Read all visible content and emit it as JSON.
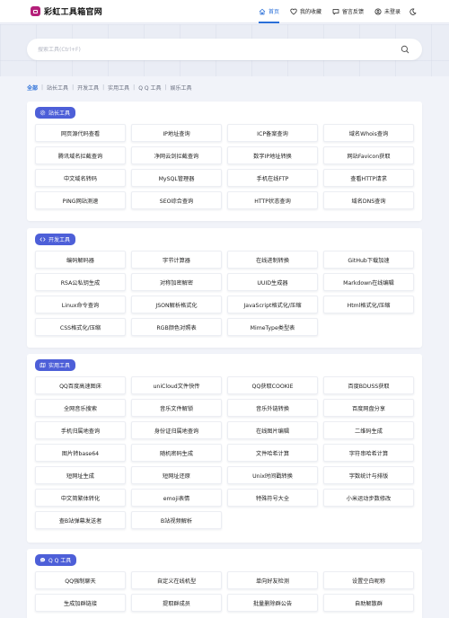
{
  "header": {
    "brand": "彩虹工具箱官网",
    "nav": [
      {
        "label": "首页",
        "icon": "home-icon",
        "active": true
      },
      {
        "label": "我的收藏",
        "icon": "heart-icon",
        "active": false
      },
      {
        "label": "留言反馈",
        "icon": "message-icon",
        "active": false
      },
      {
        "label": "未登录",
        "icon": "user-icon",
        "active": false
      }
    ],
    "theme_icon": "moon-icon"
  },
  "search": {
    "placeholder": "搜索工具(Ctrl+F)",
    "value": ""
  },
  "categories": [
    {
      "label": "全部",
      "active": true
    },
    {
      "label": "站长工具"
    },
    {
      "label": "开发工具"
    },
    {
      "label": "实用工具"
    },
    {
      "label": "Q Q 工具"
    },
    {
      "label": "娱乐工具"
    }
  ],
  "colors": {
    "accent": "#2a6fd8",
    "tag": "#4d5fd8",
    "brand": "#b4207a"
  },
  "sections": [
    {
      "title": "站长工具",
      "icon": "gear-icon",
      "tools": [
        "网页源代码查看",
        "IP地址查询",
        "ICP备案查询",
        "域名Whois查询",
        "腾讯域名拦截查询",
        "净网云剑拦截查询",
        "数字IP地址转换",
        "网站Favicon获取",
        "中文域名转码",
        "MySQL管理器",
        "手机在线FTP",
        "查看HTTP请求",
        "PING网站测速",
        "SEO综合查询",
        "HTTP状态查询",
        "域名DNS查询"
      ]
    },
    {
      "title": "开发工具",
      "icon": "code-icon",
      "tools": [
        "编码解码器",
        "字节计算器",
        "在线进制转换",
        "GitHub下载加速",
        "RSA公私钥生成",
        "对称加密解密",
        "UUID生成器",
        "Markdown在线编辑",
        "Linux命令查询",
        "JSON解析格式化",
        "JavaScript格式化/压缩",
        "Html格式化/压缩",
        "CSS格式化/压缩",
        "RGB颜色对照表",
        "MimeType类型表"
      ]
    },
    {
      "title": "实用工具",
      "icon": "map-icon",
      "tools": [
        "QQ百度高速图床",
        "uniCloud文件快传",
        "QQ获取COOKIE",
        "百度BDUSS获取",
        "全网音乐搜索",
        "音乐文件解锁",
        "音乐外链转换",
        "百度网盘分享",
        "手机归属地查询",
        "身份证归属地查询",
        "在线图片编辑",
        "二维码生成",
        "图片转base64",
        "随机密码生成",
        "文件哈希计算",
        "字符串哈希计算",
        "短网址生成",
        "短网址还原",
        "Unix时间戳转换",
        "字数统计与排版",
        "中文简繁体转化",
        "emoji表情",
        "特殊符号大全",
        "小米运动步数修改",
        "查B站弹幕发送者",
        "B站视频解析"
      ]
    },
    {
      "title": "Q Q 工具",
      "icon": "chat-icon",
      "tools": [
        "QQ强制聊天",
        "自定义在线机型",
        "单向好友检测",
        "设置空白昵称",
        "生成加群链接",
        "提取群成员",
        "批量删除群公告",
        "自助解散群"
      ]
    }
  ]
}
